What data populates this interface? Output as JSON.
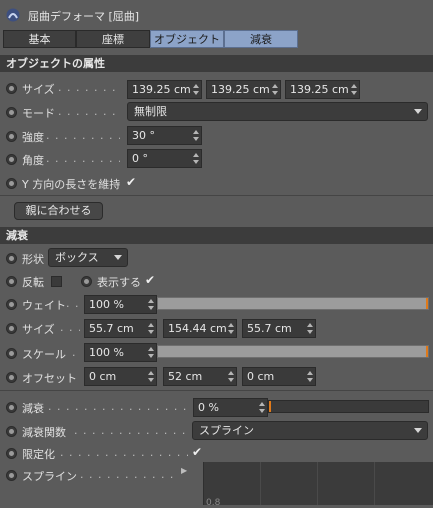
{
  "title": "屈曲デフォーマ [屈曲]",
  "tabs": [
    "基本",
    "座標",
    "オブジェクト",
    "減衰"
  ],
  "sections": {
    "object": "オブジェクトの属性",
    "falloff": "減衰"
  },
  "object": {
    "size_label": "サイズ",
    "size_values": [
      "139.25 cm",
      "139.25 cm",
      "139.25 cm"
    ],
    "mode_label": "モード",
    "mode_value": "無制限",
    "strength_label": "強度",
    "strength_value": "30 °",
    "angle_label": "角度",
    "angle_value": "0 °",
    "keep_y_label": "Y 方向の長さを維持",
    "fit_button": "親に合わせる"
  },
  "falloff": {
    "shape_label": "形状",
    "shape_value": "ボックス",
    "invert_label": "反転",
    "show_label": "表示する",
    "weight_label": "ウェイト",
    "weight_value": "100 %",
    "weight_percent": 100,
    "size_label": "サイズ",
    "size_values": [
      "55.7 cm",
      "154.44 cm",
      "55.7 cm"
    ],
    "scale_label": "スケール",
    "scale_value": "100 %",
    "scale_percent": 100,
    "offset_label": "オフセット",
    "offset_values": [
      "0 cm",
      "52 cm",
      "0 cm"
    ],
    "falloff_label": "減衰",
    "falloff_value": "0 %",
    "falloff_percent": 0,
    "func_label": "減衰関数",
    "func_value": "スプライン",
    "clamp_label": "限定化",
    "spline_label": "スプライン",
    "graph_tick": "0.8"
  },
  "colors": {
    "active_tab": "#8ca3c8",
    "slider_tick": "#e07a1a"
  }
}
